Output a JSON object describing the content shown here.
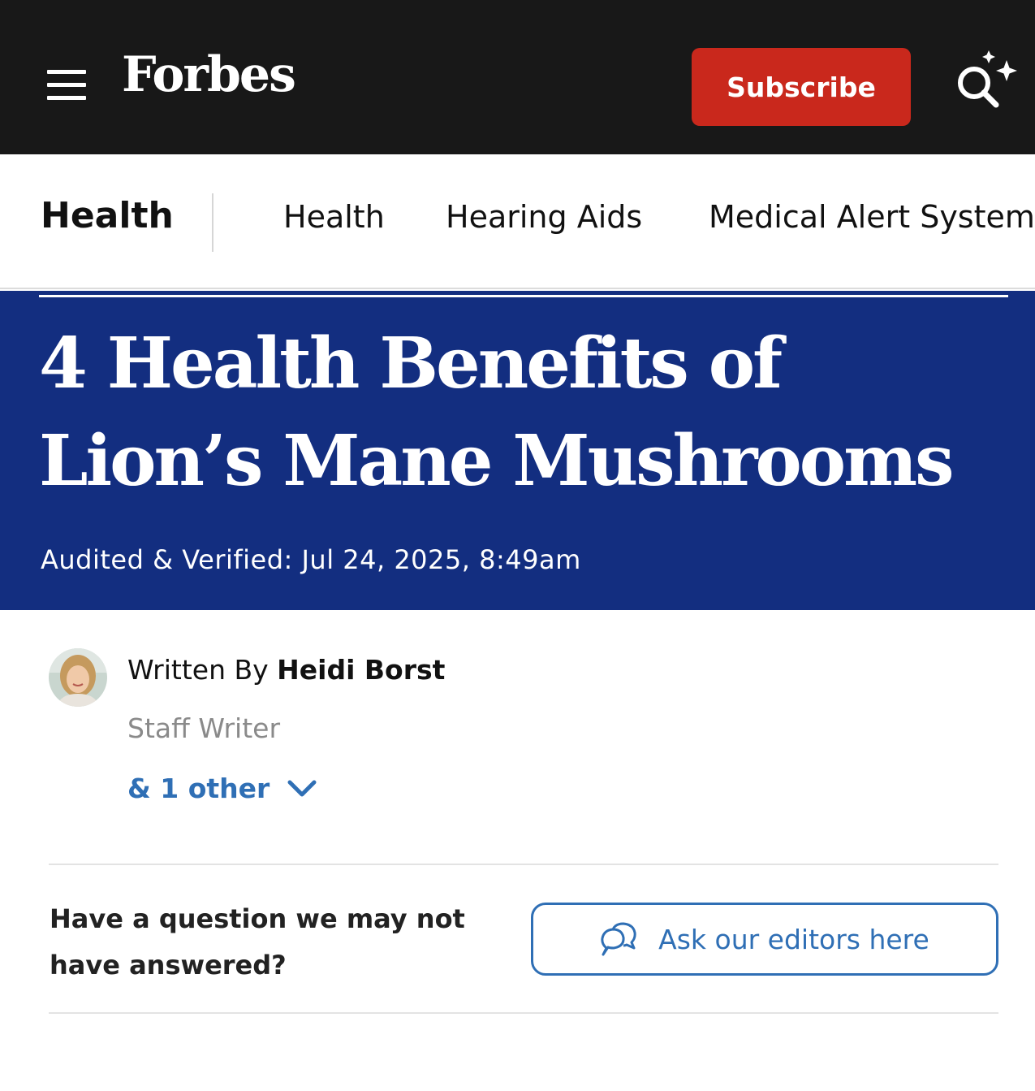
{
  "header": {
    "logo_text": "Forbes",
    "subscribe_label": "Subscribe",
    "colors": {
      "bar": "#181818",
      "subscribe": "#c9281c"
    },
    "icons": [
      "menu-icon",
      "ai-search-icon"
    ]
  },
  "section_nav": {
    "title": "Health",
    "links": [
      {
        "label": "Health"
      },
      {
        "label": "Hearing Aids"
      },
      {
        "label": "Medical Alert System"
      }
    ]
  },
  "article": {
    "title": "4 Health Benefits of Lion’s Mane Mushrooms",
    "date_line": "Audited & Verified: Jul 24, 2025, 8:49am",
    "hero_color": "#132e80"
  },
  "byline": {
    "written_prefix": "Written By",
    "author": "Heidi Borst",
    "role": "Staff Writer",
    "others_label": "& 1 other",
    "link_color": "#2f6fb5"
  },
  "question": {
    "text": "Have a question we may not have answered?",
    "button_label": "Ask our editors here",
    "button_icon": "chat-bubbles-icon"
  }
}
